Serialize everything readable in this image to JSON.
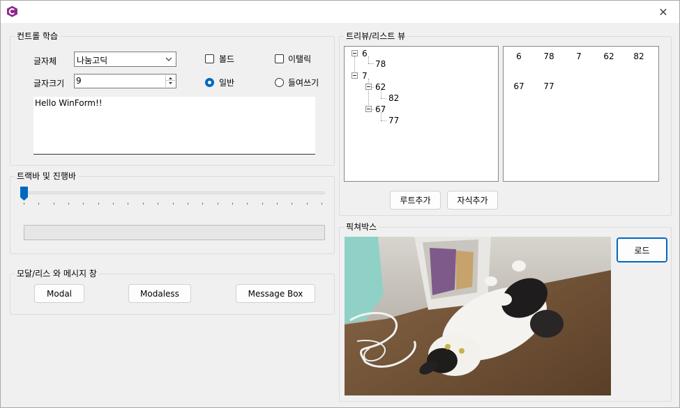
{
  "titlebar": {
    "close_glyph": "✕"
  },
  "groups": {
    "control": "컨트롤 학습",
    "tree_list": "트리뷰/리스트 뷰",
    "track_progress": "트랙바 및 진행바",
    "modal": "모달/리스 와 메시지 창",
    "picture": "픽쳐박스"
  },
  "control": {
    "font_label": "글자체",
    "font_value": "나눔고딕",
    "size_label": "글자크기",
    "size_value": "9",
    "bold_label": "볼드",
    "italic_label": "이탤릭",
    "normal_label": "일반",
    "indent_label": "들여쓰기",
    "text_value": "Hello WinForm!!"
  },
  "tree": {
    "nodes": [
      "6",
      "78",
      "7",
      "62",
      "82",
      "67",
      "77"
    ]
  },
  "list": {
    "items": [
      "6",
      "78",
      "7",
      "62",
      "82",
      "67",
      "77"
    ]
  },
  "tree_buttons": {
    "add_root": "루트추가",
    "add_child": "자식추가"
  },
  "trackbar": {
    "value": 0,
    "max": 20
  },
  "progress": {
    "value": 0
  },
  "modal_buttons": {
    "modal": "Modal",
    "modaless": "Modaless",
    "message_box": "Message Box"
  },
  "picture": {
    "load_label": "로드"
  },
  "colors": {
    "accent": "#0067c0",
    "icon": "#8e2a8e"
  },
  "icons": {
    "app": "csharp-app-icon",
    "close": "close-icon",
    "dropdown": "chevron-down-icon"
  }
}
